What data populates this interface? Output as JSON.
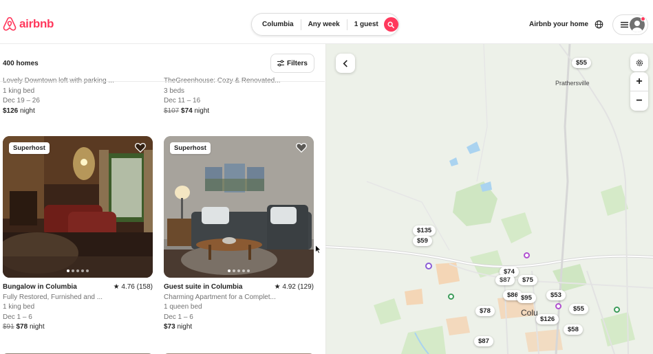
{
  "brand": {
    "name": "airbnb",
    "color": "#ff385c"
  },
  "search": {
    "location": "Columbia",
    "dates": "Any week",
    "guests": "1 guest"
  },
  "nav": {
    "host_link": "Airbnb your home"
  },
  "listings_header": {
    "count": "400 homes",
    "filters_label": "Filters"
  },
  "listings": [
    {
      "subtitle": "Lovely Downtown loft with parking ...",
      "beds": "1 king bed",
      "dates": "Dec 19 – 26",
      "price": "$126",
      "unit": "night"
    },
    {
      "subtitle": "TheGreenhouse: Cozy & Renovated...",
      "beds": "3 beds",
      "dates": "Dec 11 – 16",
      "old_price": "$107",
      "price": "$74",
      "unit": "night"
    },
    {
      "badge": "Superhost",
      "title": "Bungalow in Columbia",
      "rating": "★ 4.76 (158)",
      "subtitle": "Fully Restored, Furnished and ...",
      "beds": "1 king bed",
      "dates": "Dec 1 – 6",
      "old_price": "$91",
      "price": "$78",
      "unit": "night"
    },
    {
      "badge": "Superhost",
      "title": "Guest suite in Columbia",
      "rating": "★ 4.92 (129)",
      "subtitle": "Charming Apartment for a Complet...",
      "beds": "1 queen bed",
      "dates": "Dec 1 – 6",
      "price": "$73",
      "unit": "night"
    }
  ],
  "map": {
    "labels": {
      "town": "Prathersville",
      "city": "Colu"
    },
    "pins": [
      "$55",
      "$135",
      "$59",
      "$74",
      "$87",
      "$75",
      "$86",
      "$95",
      "$53",
      "$78",
      "$55",
      "$126",
      "$58",
      "$87"
    ]
  },
  "icons": {
    "logo": "airbnb-logo-icon",
    "search": "search-icon",
    "globe": "globe-icon",
    "menu": "hamburger-icon",
    "avatar": "user-avatar-icon",
    "filters": "filters-icon",
    "heart": "heart-icon",
    "back": "chevron-left-icon",
    "settings": "gear-icon",
    "zoom_in": "plus-icon",
    "zoom_out": "minus-icon"
  },
  "colors": {
    "accent": "#ff385c",
    "map_bg": "#ecf1e8",
    "park": "#cfe7c1",
    "urban": "#f3c9a5"
  }
}
